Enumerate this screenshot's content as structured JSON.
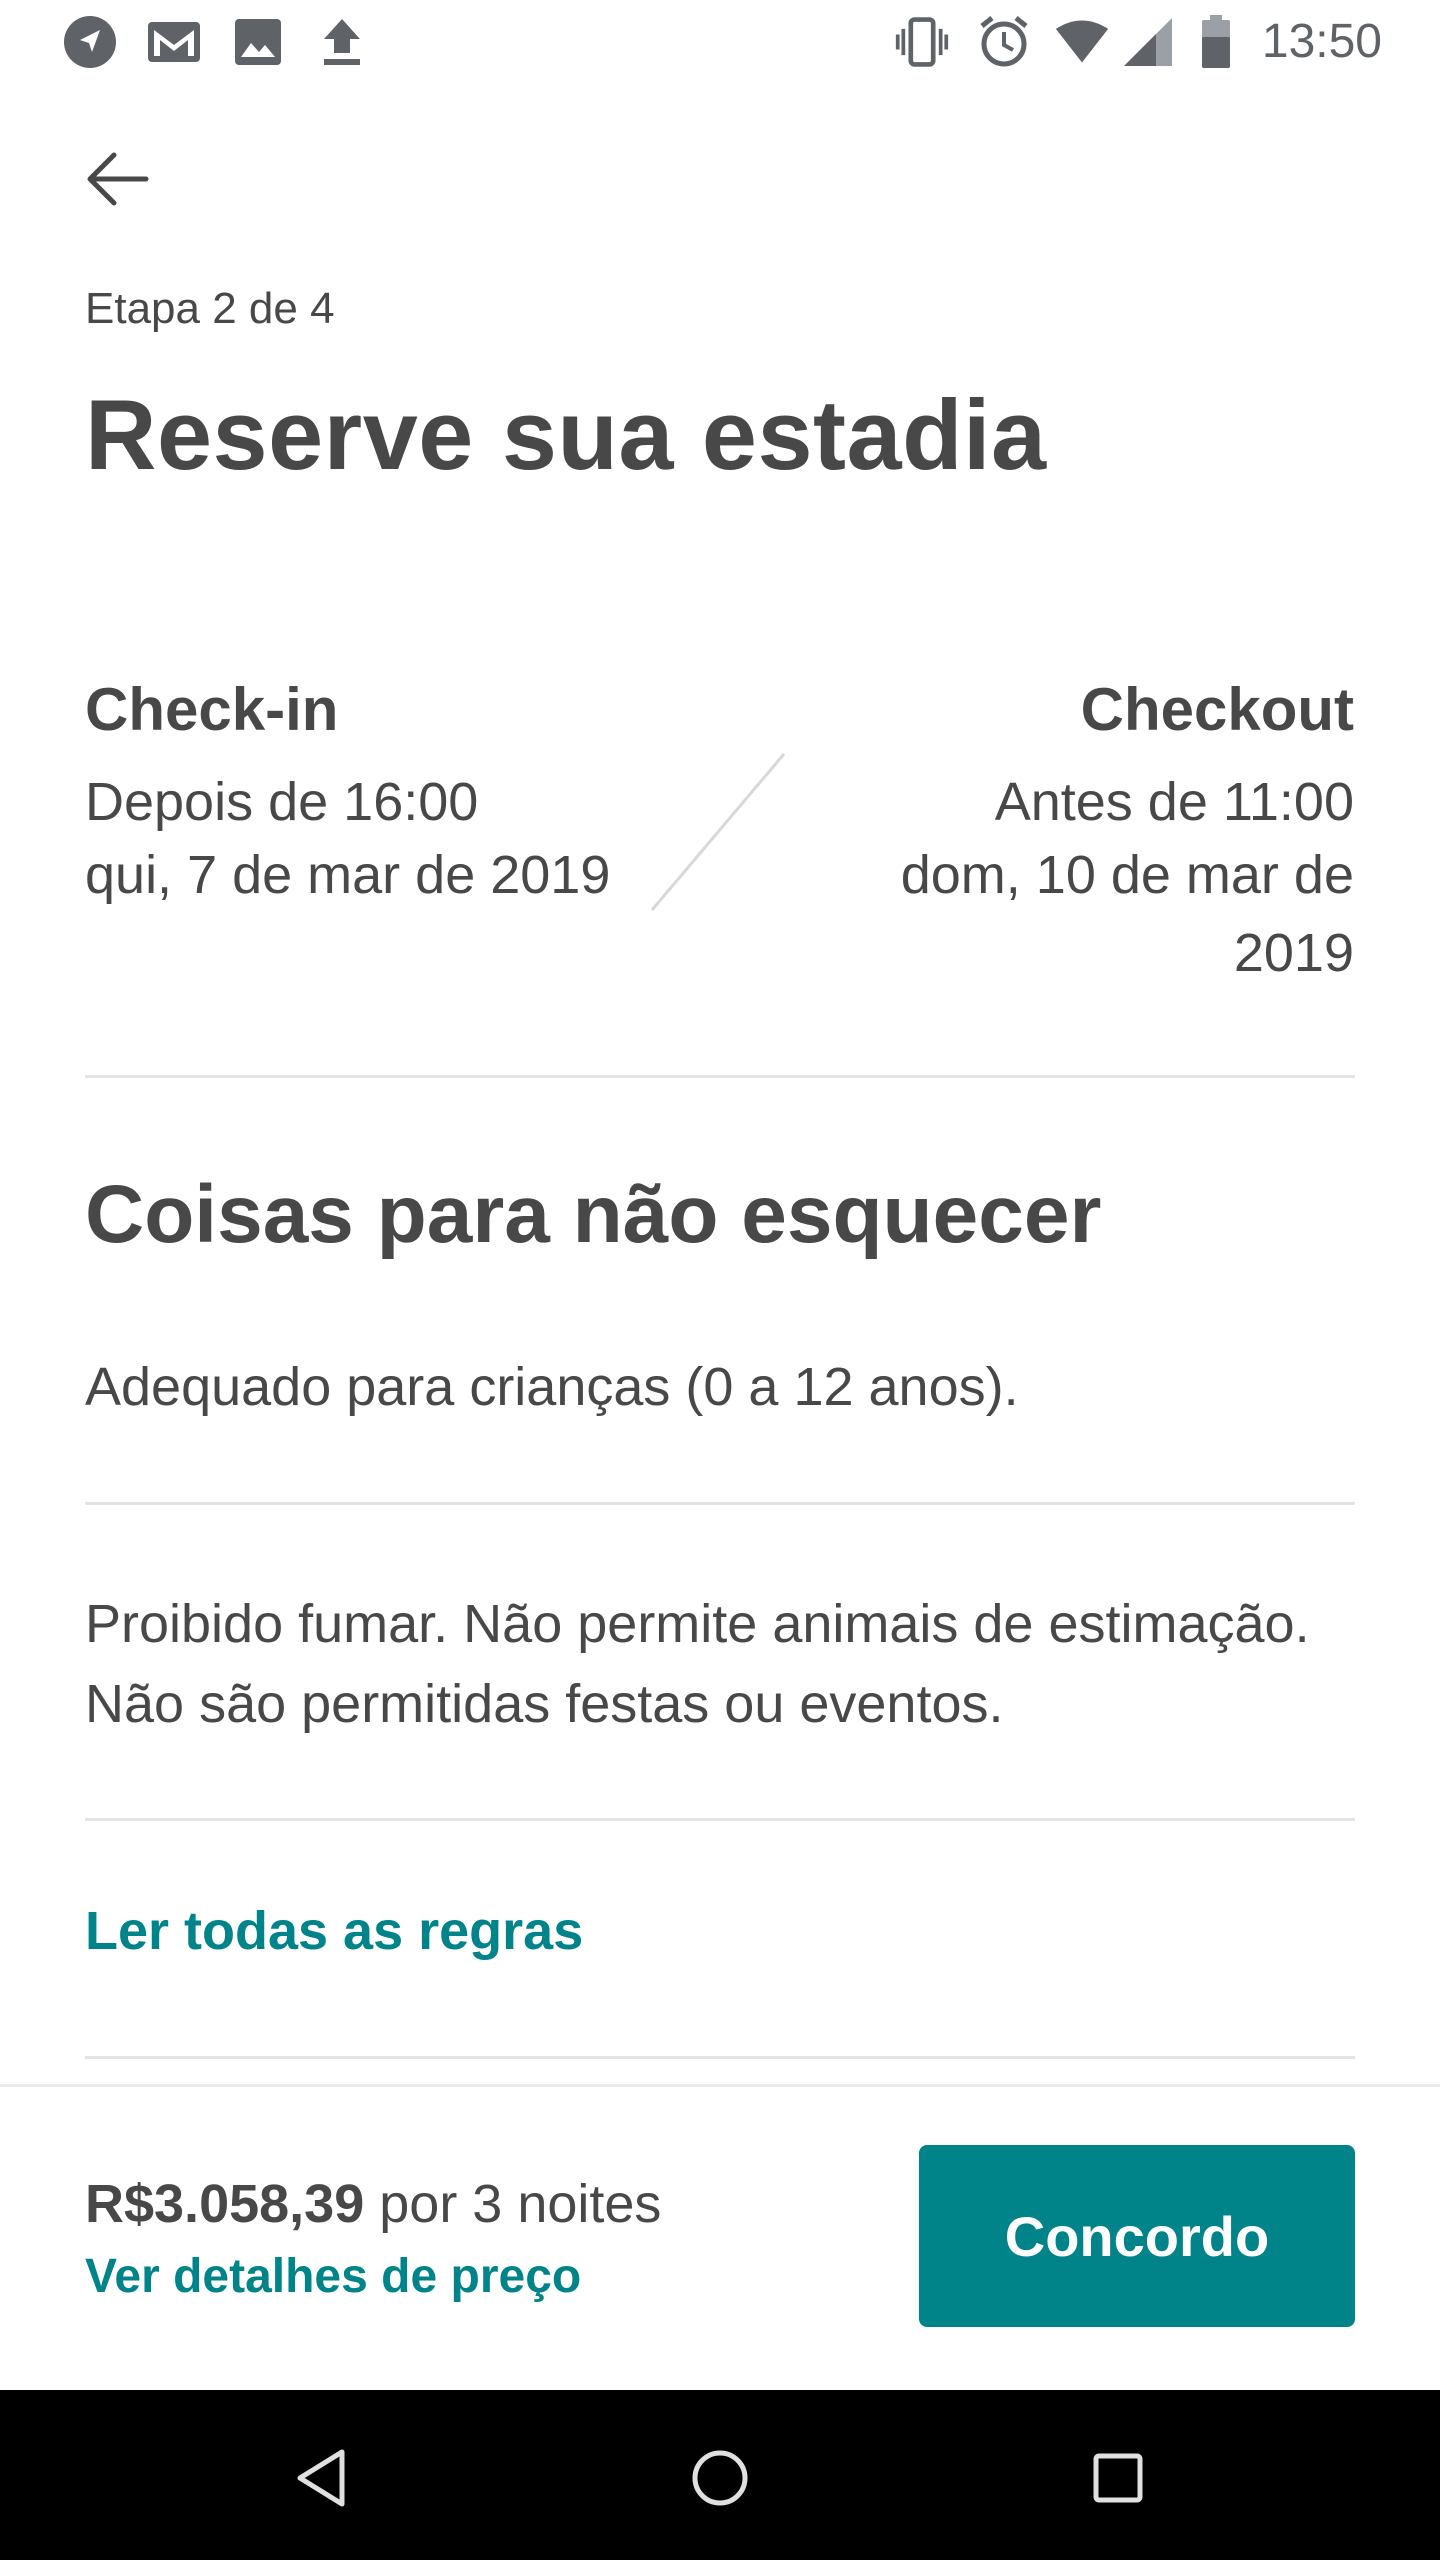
{
  "status_bar": {
    "time": "13:50",
    "left_icons": [
      "navigation-icon",
      "gmail-icon",
      "image-icon",
      "upload-icon"
    ],
    "right_icons": [
      "vibrate-icon",
      "alarm-icon",
      "wifi-icon",
      "signal-icon",
      "battery-icon"
    ]
  },
  "header": {
    "step": "Etapa 2 de 4",
    "title": "Reserve sua estadia"
  },
  "checkin": {
    "heading": "Check-in",
    "time": "Depois de 16:00",
    "date": "qui, 7 de mar de 2019"
  },
  "checkout": {
    "heading": "Checkout",
    "time": "Antes de 11:00",
    "date": "dom, 10 de mar de 2019"
  },
  "rules": {
    "title": "Coisas para não esquecer",
    "items": [
      "Adequado para crianças (0 a 12 anos).",
      "Proibido fumar. Não permite animais de estimação. Não são permitidas festas ou eventos."
    ],
    "read_all_link": "Ler todas as regras"
  },
  "footer": {
    "price": "R$3.058,39",
    "price_suffix": "por 3 noites",
    "details_link": "Ver detalhes de preço",
    "agree_button": "Concordo"
  },
  "colors": {
    "accent": "#008489",
    "text": "#484848",
    "divider": "#e4e4e4"
  },
  "nav_bar": {
    "icons": [
      "back-triangle-icon",
      "home-circle-icon",
      "recents-square-icon"
    ]
  }
}
